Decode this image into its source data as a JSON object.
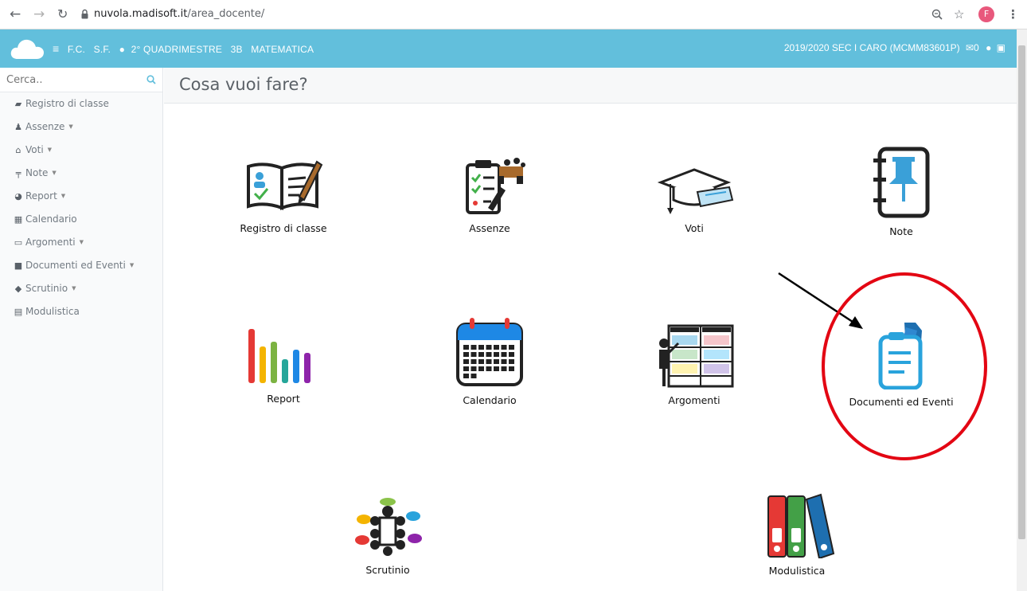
{
  "browser": {
    "url_host": "nuvola.madisoft.it",
    "url_path": "/area_docente/",
    "profile_initial": "F"
  },
  "header": {
    "crumbs": [
      "F.C.",
      "S.F.",
      "2° QUADRIMESTRE",
      "3B",
      "MATEMATICA"
    ],
    "right_text": "2019/2020  SEC I CARO (MCMM83601P)",
    "mail_count": "0"
  },
  "sidebar": {
    "search_placeholder": "Cerca..",
    "items": [
      {
        "label": "Registro di classe",
        "icon": "book-icon"
      },
      {
        "label": "Assenze",
        "icon": "user-icon"
      },
      {
        "label": "Voti",
        "icon": "institution-icon"
      },
      {
        "label": "Note",
        "icon": "pin-icon"
      },
      {
        "label": "Report",
        "icon": "pie-chart-icon"
      },
      {
        "label": "Calendario",
        "icon": "calendar-icon"
      },
      {
        "label": "Argomenti",
        "icon": "folder-open-icon"
      },
      {
        "label": "Documenti ed Eventi",
        "icon": "archive-icon"
      },
      {
        "label": "Scrutinio",
        "icon": "graduation-cap-icon"
      },
      {
        "label": "Modulistica",
        "icon": "briefcase-icon"
      }
    ]
  },
  "main": {
    "title": "Cosa vuoi fare?",
    "tiles": [
      {
        "label": "Registro di classe"
      },
      {
        "label": "Assenze"
      },
      {
        "label": "Voti"
      },
      {
        "label": "Note"
      },
      {
        "label": "Report"
      },
      {
        "label": "Calendario"
      },
      {
        "label": "Argomenti"
      },
      {
        "label": "Documenti ed Eventi"
      },
      {
        "label": "Scrutinio"
      },
      {
        "label": "Modulistica"
      }
    ]
  },
  "colors": {
    "header": "#62bfdc",
    "annotation": "#e30613"
  }
}
